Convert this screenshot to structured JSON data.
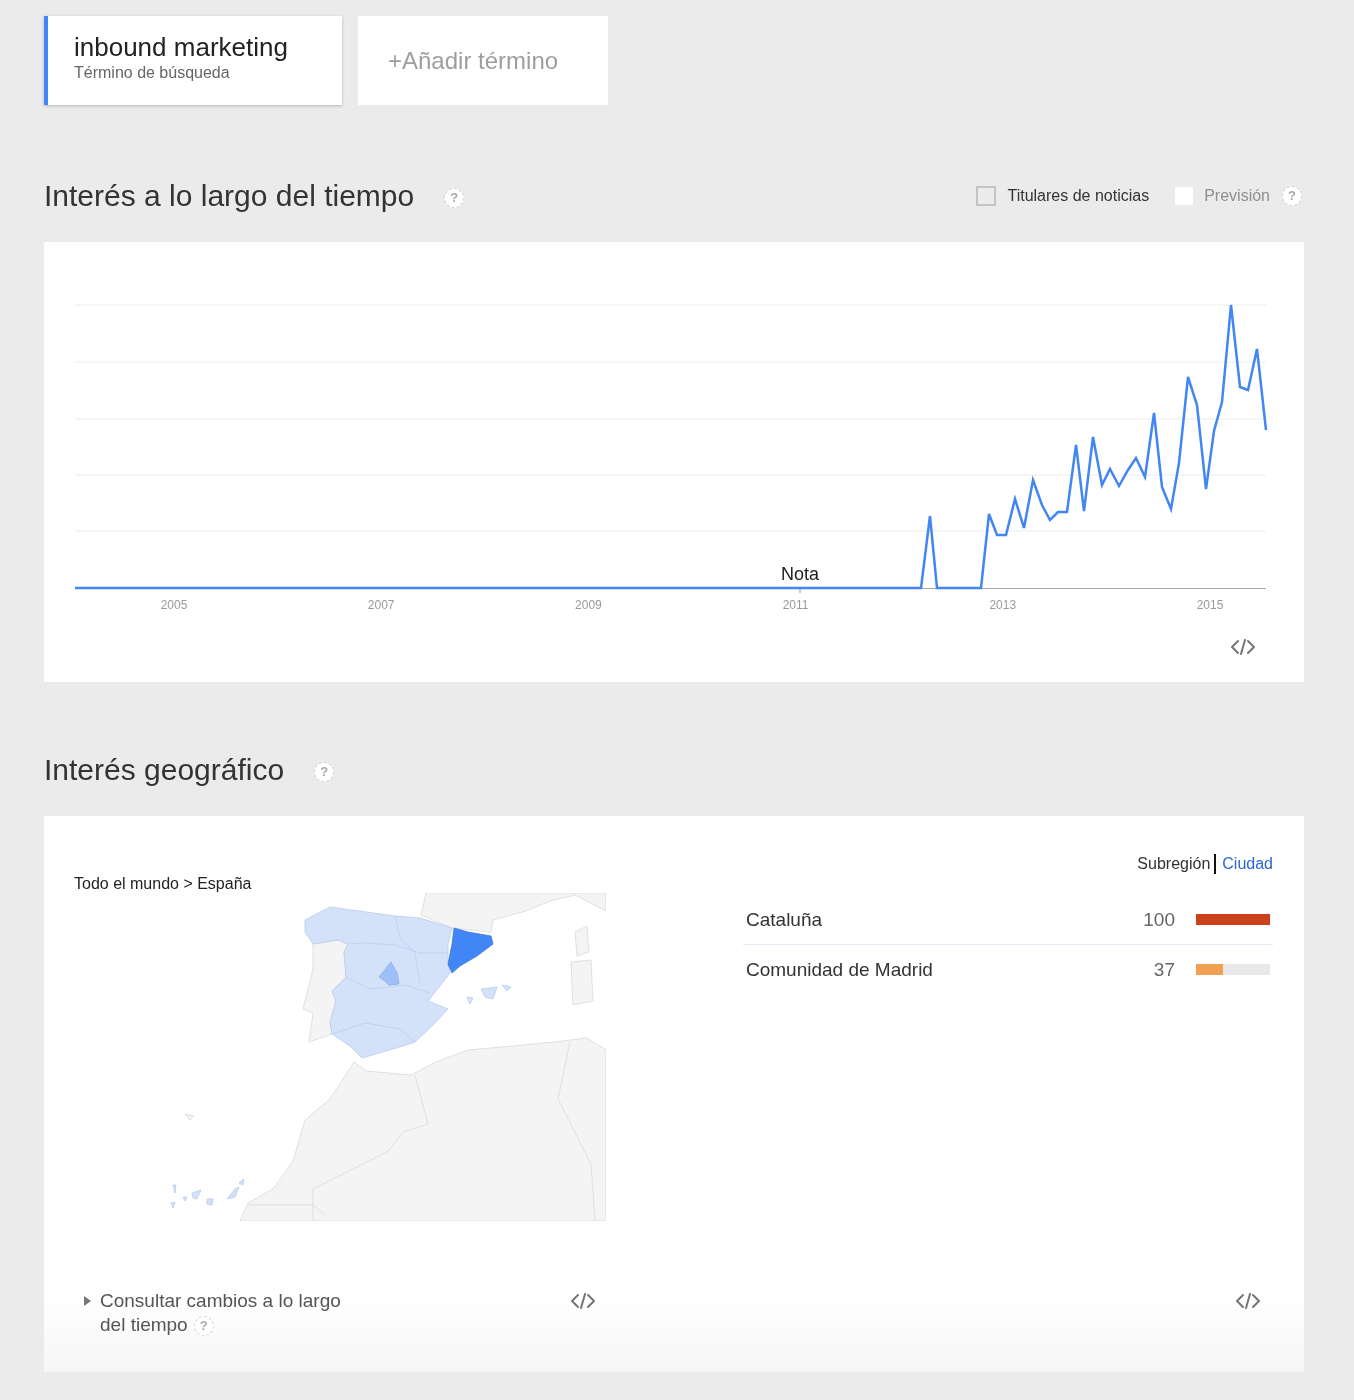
{
  "terms": [
    {
      "kind": "term",
      "label": "inbound marketing",
      "sublabel": "Término de búsqueda",
      "color": "#4285f4"
    },
    {
      "kind": "add",
      "label": "+Añadir término"
    }
  ],
  "interest_over_time": {
    "title": "Interés a lo largo del tiempo",
    "help": "?",
    "options": [
      {
        "label": "Titulares de noticias",
        "checked": false,
        "disabled": false
      },
      {
        "label": "Previsión",
        "checked": false,
        "disabled": true
      }
    ],
    "options_help": "?",
    "x_labels": [
      "2005",
      "2007",
      "2009",
      "2011",
      "2013",
      "2015"
    ],
    "note": "Nota"
  },
  "geographic_interest": {
    "title": "Interés geográfico",
    "help": "?",
    "breadcrumb": "Todo el mundo > España",
    "views": [
      {
        "label": "Subregión",
        "selected": true
      },
      {
        "label": "Ciudad",
        "selected": false
      }
    ],
    "regions": [
      {
        "name": "Cataluña",
        "value": "100",
        "level": 1,
        "color": "#cb4119"
      },
      {
        "name": "Comunidad de Madrid",
        "value": "37",
        "level": 0.37,
        "color": "#eea152"
      }
    ],
    "changes_toggle": {
      "label": "Consultar cambios a lo largo del tiempo",
      "expanded": false,
      "help": "?"
    }
  }
}
